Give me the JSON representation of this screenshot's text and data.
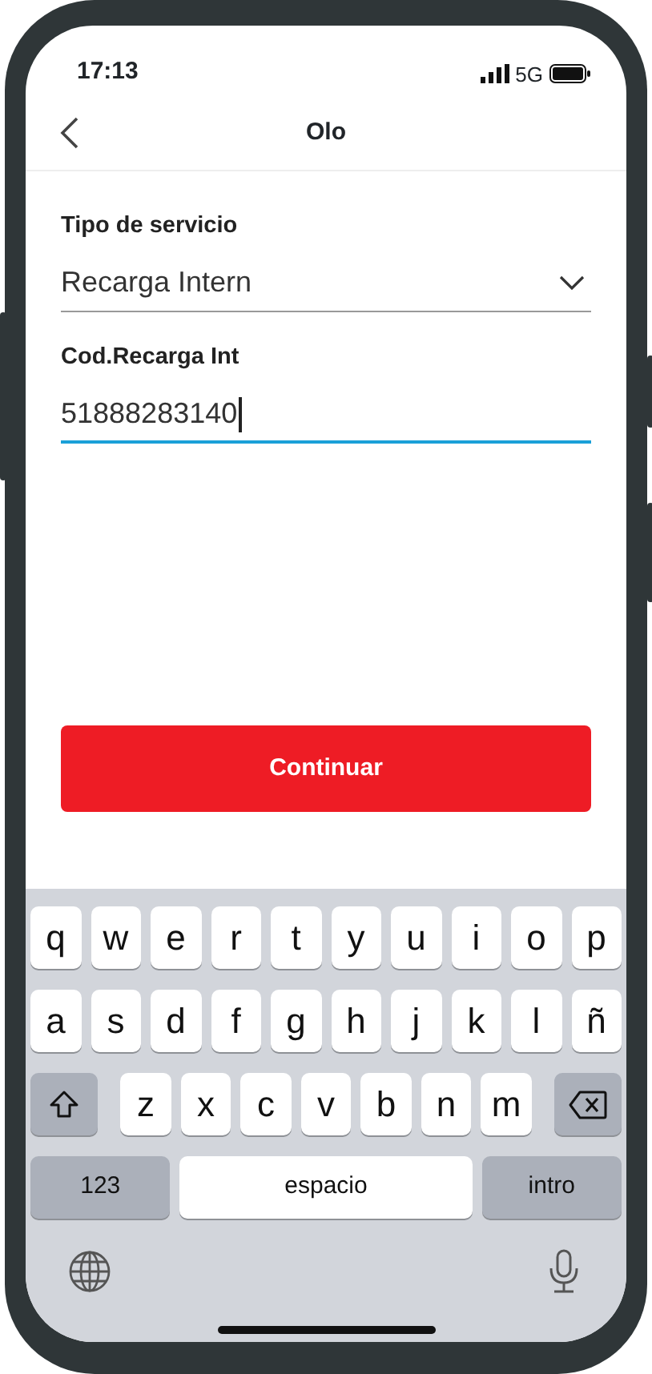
{
  "status_bar": {
    "time": "17:13",
    "network": "5G"
  },
  "header": {
    "title": "Olo"
  },
  "fields": [
    {
      "kind": "select",
      "label": "Tipo de servicio",
      "value": "Recarga Intern",
      "focused": false
    },
    {
      "kind": "text",
      "label": "Cod.Recarga Int",
      "value": "51888283140",
      "focused": true
    }
  ],
  "primary_button": {
    "label": "Continuar"
  },
  "keyboard": {
    "rows": [
      [
        {
          "kind": "letter",
          "label": "q"
        },
        {
          "kind": "letter",
          "label": "w"
        },
        {
          "kind": "letter",
          "label": "e"
        },
        {
          "kind": "letter",
          "label": "r"
        },
        {
          "kind": "letter",
          "label": "t"
        },
        {
          "kind": "letter",
          "label": "y"
        },
        {
          "kind": "letter",
          "label": "u"
        },
        {
          "kind": "letter",
          "label": "i"
        },
        {
          "kind": "letter",
          "label": "o"
        },
        {
          "kind": "letter",
          "label": "p"
        }
      ],
      [
        {
          "kind": "letter",
          "label": "a"
        },
        {
          "kind": "letter",
          "label": "s"
        },
        {
          "kind": "letter",
          "label": "d"
        },
        {
          "kind": "letter",
          "label": "f"
        },
        {
          "kind": "letter",
          "label": "g"
        },
        {
          "kind": "letter",
          "label": "h"
        },
        {
          "kind": "letter",
          "label": "j"
        },
        {
          "kind": "letter",
          "label": "k"
        },
        {
          "kind": "letter",
          "label": "l"
        },
        {
          "kind": "letter",
          "label": "ñ"
        }
      ],
      [
        {
          "kind": "shift"
        },
        {
          "kind": "letter",
          "label": "z"
        },
        {
          "kind": "letter",
          "label": "x"
        },
        {
          "kind": "letter",
          "label": "c"
        },
        {
          "kind": "letter",
          "label": "v"
        },
        {
          "kind": "letter",
          "label": "b"
        },
        {
          "kind": "letter",
          "label": "n"
        },
        {
          "kind": "letter",
          "label": "m"
        },
        {
          "kind": "delete"
        }
      ]
    ],
    "numbers_key": "123",
    "space_key": "espacio",
    "return_key": "intro"
  }
}
